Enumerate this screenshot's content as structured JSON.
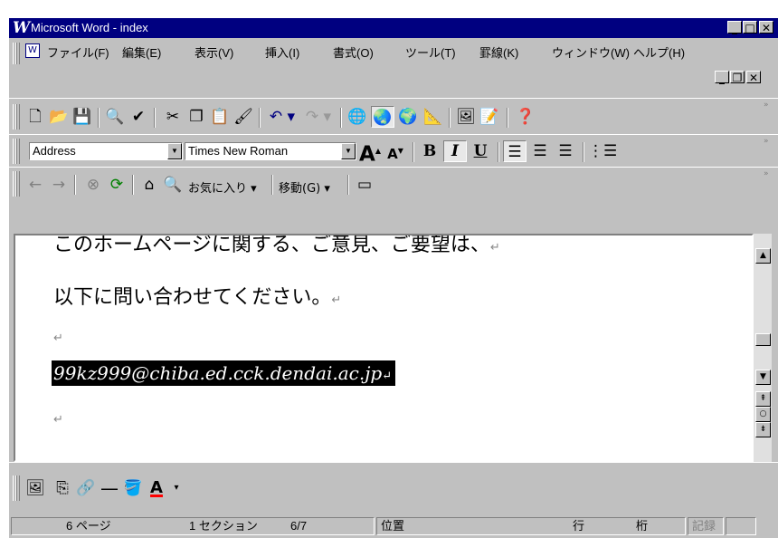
{
  "window": {
    "title": "Microsoft Word - index",
    "app_logo": "W"
  },
  "caption_buttons": {
    "minimize": "_",
    "restore": "□",
    "close": "✕"
  },
  "menu": [
    "ファイル(F)",
    "編集(E)",
    "表示(V)",
    "挿入(I)",
    "書式(O)",
    "ツール(T)",
    "罫線(K)",
    "ウィンドウ(W)",
    "ヘルプ(H)"
  ],
  "doc_buttons": {
    "minimize": "_",
    "restore": "❐",
    "close": "✕"
  },
  "formatting": {
    "style": "Address",
    "font": "Times New Roman",
    "grow": "A",
    "shrink": "A",
    "bold": "B",
    "italic": "I",
    "underline": "U"
  },
  "web": {
    "favorites": "お気に入り",
    "goto": "移動(G)"
  },
  "document": {
    "line1": "このホームページに関する、ご意見、ご要望は、",
    "line2": "以下に問い合わせてください。",
    "email": "99kz999@chiba.ed.cck.dendai.ac.jp",
    "para_mark": "↵"
  },
  "status": {
    "page": "6 ページ",
    "section": "1 セクション",
    "pages": "6/7",
    "position": "位置",
    "line": "行",
    "column": "桁",
    "record": "記録"
  },
  "colors": {
    "titlebar": "#000080",
    "face": "#c0c0c0",
    "font_color_bar": "#ff0000"
  }
}
